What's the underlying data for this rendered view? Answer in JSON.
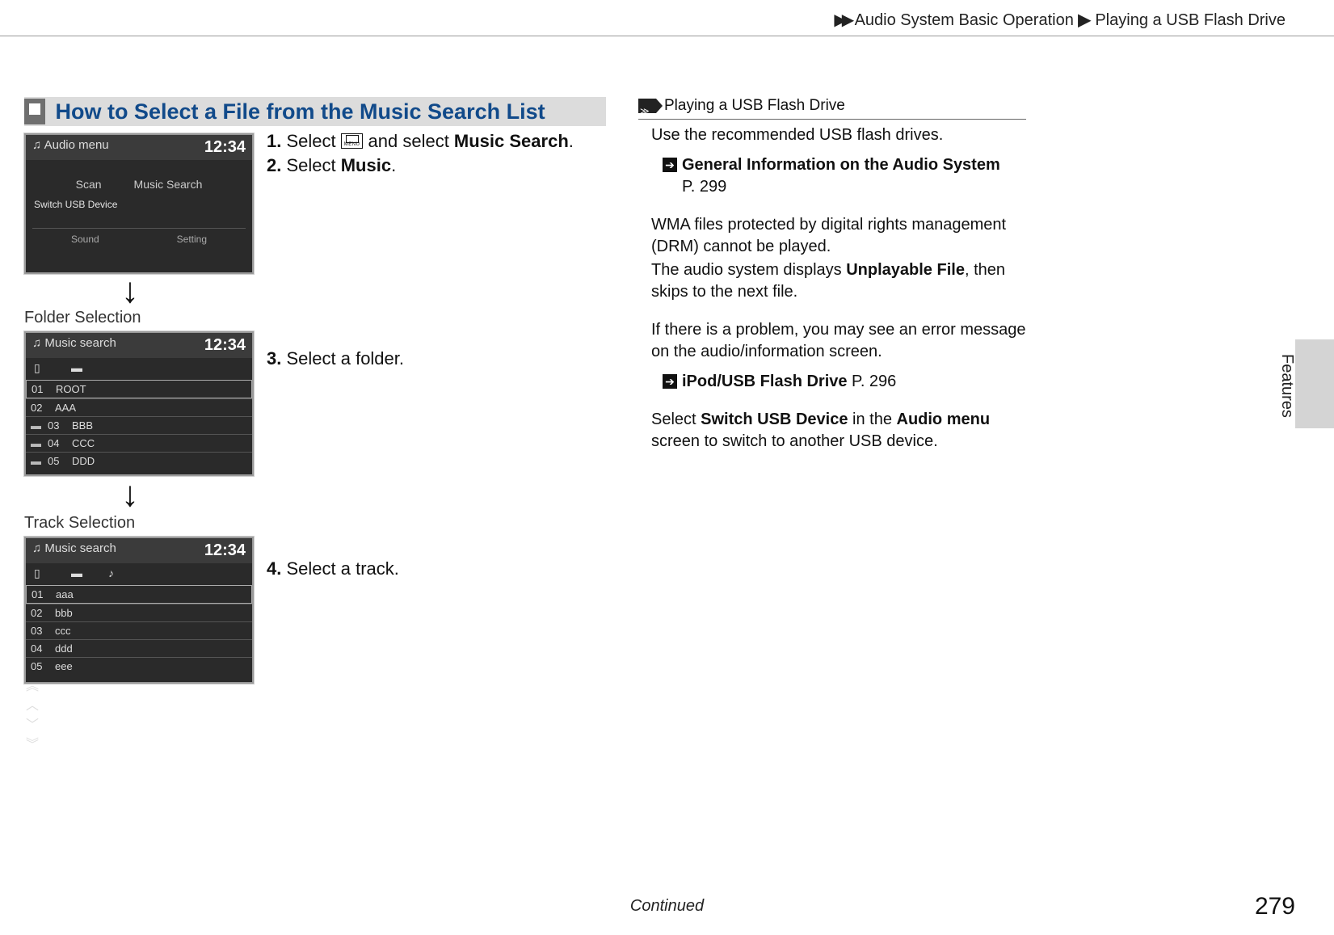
{
  "breadcrumb": {
    "level1": "Audio System Basic Operation",
    "level2": "Playing a USB Flash Drive"
  },
  "section_title": "How to Select a File from the Music Search List",
  "screens": {
    "audio_menu": {
      "title": "Audio menu",
      "time": "12:34",
      "btn_scan": "Scan",
      "btn_music_search": "Music Search",
      "switch_usb": "Switch USB Device",
      "footer_sound": "Sound",
      "footer_setting": "Setting"
    },
    "folder": {
      "caption": "Folder Selection",
      "title": "Music search",
      "time": "12:34",
      "rows": [
        {
          "idx": "01",
          "name": "ROOT"
        },
        {
          "idx": "02",
          "name": "AAA"
        },
        {
          "idx": "03",
          "name": "BBB"
        },
        {
          "idx": "04",
          "name": "CCC"
        },
        {
          "idx": "05",
          "name": "DDD"
        }
      ]
    },
    "track": {
      "caption": "Track Selection",
      "title": "Music search",
      "time": "12:34",
      "rows": [
        {
          "idx": "01",
          "name": "aaa"
        },
        {
          "idx": "02",
          "name": "bbb"
        },
        {
          "idx": "03",
          "name": "ccc"
        },
        {
          "idx": "04",
          "name": "ddd"
        },
        {
          "idx": "05",
          "name": "eee"
        }
      ]
    }
  },
  "steps": {
    "s1a": "1.",
    "s1b": " Select ",
    "s1c": " and select ",
    "s1d": "Music Search",
    "s1e": ".",
    "s2a": "2.",
    "s2b": " Select ",
    "s2c": "Music",
    "s2d": ".",
    "s3a": "3.",
    "s3b": " Select a folder.",
    "s4a": "4.",
    "s4b": " Select a track."
  },
  "menu_icon_label": "MENU",
  "sidebar": {
    "header": "Playing a USB Flash Drive",
    "p1": "Use the recommended USB flash drives.",
    "ref1_text": "General Information on the Audio System",
    "ref1_page": "P. 299",
    "p2a": "WMA files protected by digital rights management (DRM) cannot be played.",
    "p2b_pre": "The audio system displays ",
    "p2b_bold": "Unplayable File",
    "p2b_post": ", then skips to the next file.",
    "p3": "If there is a problem, you may see an error message on the audio/information screen.",
    "ref2_text": "iPod/USB Flash Drive",
    "ref2_page": " P. 296",
    "p4_pre": "Select ",
    "p4_b1": "Switch USB Device",
    "p4_mid": " in the ",
    "p4_b2": "Audio menu",
    "p4_post": " screen to switch to another USB device."
  },
  "sidetab": "Features",
  "continued": "Continued",
  "page_number": "279"
}
